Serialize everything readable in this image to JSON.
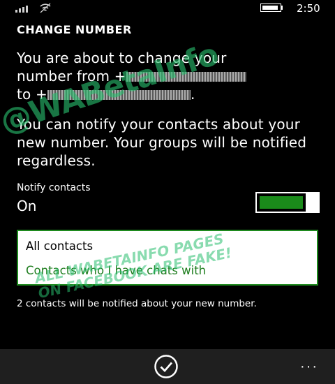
{
  "status": {
    "time": "2:50"
  },
  "page": {
    "title": "CHANGE NUMBER"
  },
  "intro": {
    "line1": "You are about to change your",
    "line2_prefix": "number from +",
    "line3_prefix": "to +",
    "line3_suffix": "."
  },
  "notify_info": "You can notify your contacts about your new number. Your groups will be notified regardless.",
  "notify": {
    "label": "Notify contacts",
    "value": "On",
    "on": true
  },
  "options": [
    "All contacts",
    "Contacts who I have chats with"
  ],
  "footer_info": "2 contacts will be notified about your new number.",
  "watermark": {
    "main": "@WABetaInfo",
    "line1": "ALL WABETAINFO PAGES",
    "line2": "ON FACEBOOK ARE FAKE!"
  },
  "app_bar": {
    "more_label": "···"
  },
  "colors": {
    "accent": "#1a8a1a",
    "background": "#000000",
    "app_bar": "#1f1f1f"
  },
  "icons": {
    "ok": "check-circle-icon",
    "wifi": "wifi-icon",
    "signal": "signal-icon",
    "battery": "battery-icon"
  }
}
